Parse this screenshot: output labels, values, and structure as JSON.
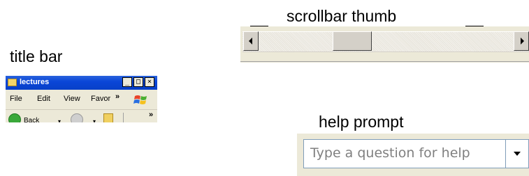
{
  "captions": {
    "scrollbar": "scrollbar thumb",
    "titlebar": "title bar",
    "help": "help prompt"
  },
  "window": {
    "title": "lectures",
    "icon": "folder-icon",
    "controls": [
      "_",
      "□",
      "×"
    ],
    "menu": [
      "File",
      "Edit",
      "View",
      "Favor"
    ],
    "menu_overflow": "»",
    "toolbar": {
      "back_label": "Back",
      "dropdown_arrow": "▾",
      "overflow": "»"
    }
  },
  "help_prompt": {
    "placeholder": "Type a question for help"
  },
  "colors": {
    "titlebar_blue": "#0a46d8",
    "chrome": "#ece9d8",
    "help_text": "#808080"
  }
}
